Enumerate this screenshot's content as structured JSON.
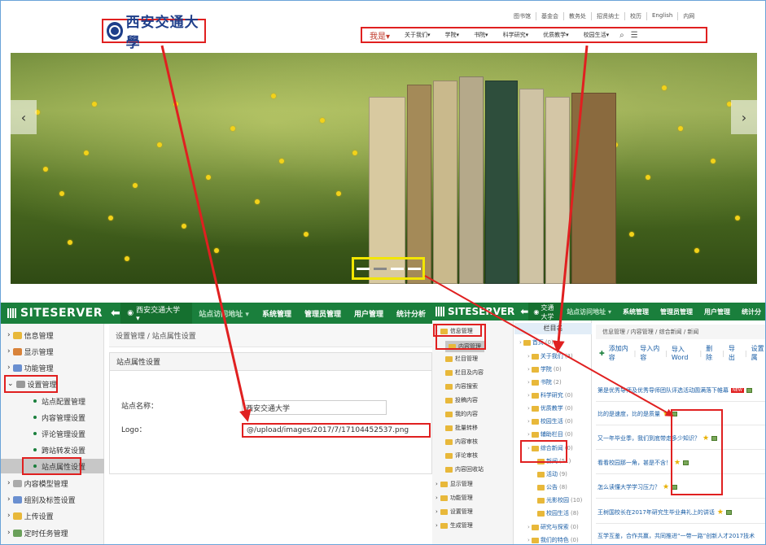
{
  "site": {
    "logo_text": "西安交通大學",
    "top_links": [
      "图书馆",
      "基金会",
      "教务处",
      "招贤纳士",
      "校历",
      "English",
      "内网"
    ],
    "nav": [
      {
        "label": "我是▾",
        "active": true
      },
      {
        "label": "关于我们▾",
        "active": false
      },
      {
        "label": "学院▾",
        "active": false
      },
      {
        "label": "书院▾",
        "active": false
      },
      {
        "label": "科学研究▾",
        "active": false
      },
      {
        "label": "优质教学▾",
        "active": false
      },
      {
        "label": "校园生活▾",
        "active": false
      }
    ],
    "search_icon": "search-icon",
    "menu_icon": "hamburger-icon",
    "carousel": {
      "prev": "‹",
      "next": "›",
      "indicator_count": 4,
      "active_index": 1
    }
  },
  "admin_left": {
    "brand": "SITESERVER",
    "back_icon": "back-arrow-icon",
    "site_selector": "西安交通大学 ▾",
    "topnav": [
      "站点访问地址 ▾",
      "系统管理",
      "管理员管理",
      "用户管理",
      "统计分析"
    ],
    "sidebar": [
      {
        "label": "信息管理",
        "level": 0,
        "color": "#e8b83a"
      },
      {
        "label": "显示管理",
        "level": 0,
        "color": "#d9833a"
      },
      {
        "label": "功能管理",
        "level": 0,
        "color": "#6a8fd0"
      },
      {
        "label": "设置管理",
        "level": 0,
        "color": "#999999",
        "expanded": true,
        "highlight": true
      },
      {
        "label": "站点配置管理",
        "level": 1
      },
      {
        "label": "内容管理设置",
        "level": 1
      },
      {
        "label": "评论管理设置",
        "level": 1
      },
      {
        "label": "跨站转发设置",
        "level": 1
      },
      {
        "label": "站点属性设置",
        "level": 1,
        "selected": true,
        "highlight": true
      },
      {
        "label": "内容模型管理",
        "level": 0,
        "color": "#aaaaaa"
      },
      {
        "label": "组别及标签设置",
        "level": 0,
        "color": "#6a8fd0"
      },
      {
        "label": "上传设置",
        "level": 0,
        "color": "#e8b83a"
      },
      {
        "label": "定时任务管理",
        "level": 0,
        "color": "#6aa05a"
      }
    ],
    "breadcrumb": "设置管理 / 站点属性设置",
    "panel_title": "站点属性设置",
    "form": {
      "site_name_label": "站点名称：",
      "site_name_value": "西安交通大学",
      "logo_label": "Logo：",
      "logo_value": "@/upload/images/2017/7/17104452537.png"
    }
  },
  "admin_right": {
    "brand": "SITESERVER",
    "site_selector": "西安交通大学 ▾",
    "topnav": [
      "站点访问地址 ▾",
      "系统管理",
      "管理员管理",
      "用户管理",
      "统计分"
    ],
    "sidebar": [
      {
        "label": "信息管理",
        "level": 0,
        "highlight": true
      },
      {
        "label": "内容管理",
        "level": 1,
        "selected": true,
        "highlight": true
      },
      {
        "label": "栏目管理",
        "level": 1
      },
      {
        "label": "栏目及内容",
        "level": 1
      },
      {
        "label": "内容搜索",
        "level": 1
      },
      {
        "label": "投稿内容",
        "level": 1
      },
      {
        "label": "我的内容",
        "level": 1
      },
      {
        "label": "批量转移",
        "level": 1
      },
      {
        "label": "内容审核",
        "level": 1
      },
      {
        "label": "评论审核",
        "level": 1
      },
      {
        "label": "内容回收站",
        "level": 1
      },
      {
        "label": "显示管理",
        "level": 0
      },
      {
        "label": "功能管理",
        "level": 0
      },
      {
        "label": "设置管理",
        "level": 0
      },
      {
        "label": "生成管理",
        "level": 0
      }
    ],
    "tree_header": "栏目名",
    "tree": [
      {
        "label": "首页",
        "count": "(0)",
        "level": 0
      },
      {
        "label": "关于我们",
        "count": "(3)",
        "level": 1
      },
      {
        "label": "学院",
        "count": "(0)",
        "level": 1
      },
      {
        "label": "书院",
        "count": "(2)",
        "level": 1
      },
      {
        "label": "科学研究",
        "count": "(0)",
        "level": 1
      },
      {
        "label": "优质教学",
        "count": "(0)",
        "level": 1
      },
      {
        "label": "校园生活",
        "count": "(0)",
        "level": 1
      },
      {
        "label": "辅助栏目",
        "count": "(0)",
        "level": 1
      },
      {
        "label": "综合新闻",
        "count": "(0)",
        "level": 1,
        "highlight": true
      },
      {
        "label": "新闻",
        "count": "(51)",
        "level": 2,
        "highlight": true
      },
      {
        "label": "活动",
        "count": "(9)",
        "level": 2
      },
      {
        "label": "公告",
        "count": "(8)",
        "level": 2
      },
      {
        "label": "光影校园",
        "count": "(10)",
        "level": 2
      },
      {
        "label": "校园生活",
        "count": "(8)",
        "level": 2
      },
      {
        "label": "研究与探索",
        "count": "(0)",
        "level": 1
      },
      {
        "label": "我们的特色",
        "count": "(0)",
        "level": 1
      }
    ],
    "breadcrumb": "信息管理 / 内容管理 / 综合新闻 / 新闻",
    "toolbar": [
      "添加内容",
      "导入内容",
      "导入Word",
      "删 除",
      "导 出",
      "设置属"
    ],
    "rows": [
      {
        "title": "第是优秀导师及优秀导师团队评选活动圆满落下帷幕",
        "new": true,
        "star": false,
        "pic": true
      },
      {
        "title": "比的是速度，比的是质量",
        "new": false,
        "star": true,
        "pic": true
      },
      {
        "title": "又一年毕业季，我们到底带走多少知识？",
        "new": false,
        "star": true,
        "pic": true
      },
      {
        "title": "看看校园那一角，甚是不含！",
        "new": false,
        "star": true,
        "pic": true
      },
      {
        "title": "怎么读懂大学学习压力？",
        "new": false,
        "star": true,
        "pic": true
      },
      {
        "title": "王树国校长在2017年研究生毕业典礼上的讲话",
        "new": false,
        "star": true,
        "pic": true
      },
      {
        "title": "互学互鉴，合作共赢，共同推进“一带一路”创新人才2017技术",
        "new": false,
        "star": false,
        "pic": false
      }
    ]
  },
  "colors": {
    "admin_green": "#1a7f3c",
    "annotation_red": "#e02020",
    "annotation_yellow": "#f2e600",
    "link_blue": "#1a5ea6"
  }
}
